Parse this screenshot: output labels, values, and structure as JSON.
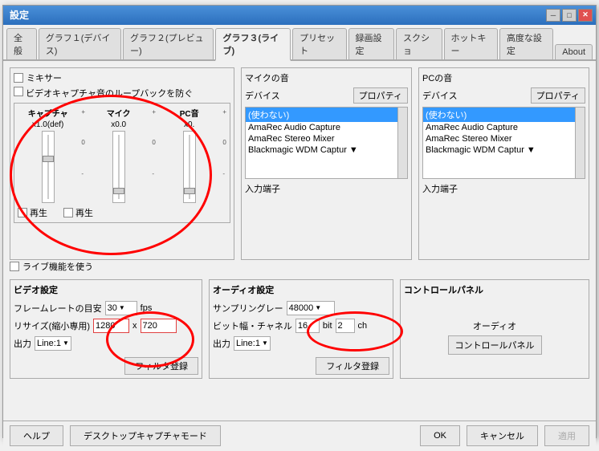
{
  "window": {
    "title": "設定",
    "titlebar_buttons": [
      "─",
      "□",
      "✕"
    ]
  },
  "tabs": [
    {
      "label": "全般",
      "active": false
    },
    {
      "label": "グラフ１(デバイス)",
      "active": false
    },
    {
      "label": "グラフ２(プレビュー)",
      "active": false
    },
    {
      "label": "グラフ３(ライブ)",
      "active": true
    },
    {
      "label": "プリセット",
      "active": false
    },
    {
      "label": "録画設定",
      "active": false
    },
    {
      "label": "スクショ",
      "active": false
    },
    {
      "label": "ホットキー",
      "active": false
    },
    {
      "label": "高度な設定",
      "active": false
    },
    {
      "label": "About",
      "active": false
    }
  ],
  "mixer": {
    "title": "ミキサー",
    "loopback_label": "ビデオキャプチャ音のループバックを防ぐ",
    "cols": [
      {
        "label": "キャプチャ",
        "value": "x1.0(def)"
      },
      {
        "label": "マイク",
        "value": "x0.0"
      },
      {
        "label": "PC音",
        "value": "x0."
      }
    ],
    "slider_marks": [
      "+",
      "0",
      "-"
    ],
    "playback": [
      {
        "label": "再生"
      },
      {
        "label": "再生"
      }
    ]
  },
  "mic_sound": {
    "title": "マイクの音",
    "device_label": "デバイス",
    "props_label": "プロパティ",
    "devices": [
      {
        "label": "(使わない)",
        "selected": true
      },
      {
        "label": "AmaRec Audio Capture",
        "selected": false
      },
      {
        "label": "AmaRec Stereo Mixer",
        "selected": false
      },
      {
        "label": "Blackmagic WDM Captur ▼",
        "selected": false
      }
    ],
    "input_terminal": "入力端子"
  },
  "pc_sound": {
    "title": "PCの音",
    "device_label": "デバイス",
    "props_label": "プロパティ",
    "devices": [
      {
        "label": "(使わない)",
        "selected": true
      },
      {
        "label": "AmaRec Audio Capture",
        "selected": false
      },
      {
        "label": "AmaRec Stereo Mixer",
        "selected": false
      },
      {
        "label": "Blackmagic WDM Captur ▼",
        "selected": false
      }
    ],
    "input_terminal": "入力端子"
  },
  "live_check": {
    "label": "ライブ機能を使う"
  },
  "video_settings": {
    "title": "ビデオ設定",
    "framerate_label": "フレームレートの目安",
    "framerate_value": "30",
    "fps_label": "fps",
    "resize_label": "リサイズ(縮小専用)",
    "resize_w": "1280",
    "resize_x": "x",
    "resize_h": "720",
    "output_label": "出力",
    "output_value": "Line:1",
    "filter_btn": "フィルタ登録"
  },
  "audio_settings": {
    "title": "オーディオ設定",
    "sampling_label": "サンプリングレー",
    "sampling_value": "48000",
    "bit_depth_label": "ビット幅・チャネル",
    "bit_value": "16",
    "bit_unit": "bit",
    "ch_value": "2",
    "ch_unit": "ch",
    "output_label": "出力",
    "output_value": "Line:1",
    "filter_btn": "フィルタ登録"
  },
  "control_panel": {
    "title": "コントロールパネル",
    "audio_label": "オーディオ",
    "panel_btn": "コントロールパネル"
  },
  "footer": {
    "help_btn": "ヘルプ",
    "desktop_btn": "デスクトップキャプチャモード",
    "ok_btn": "OK",
    "cancel_btn": "キャンセル",
    "apply_btn": "適用"
  }
}
